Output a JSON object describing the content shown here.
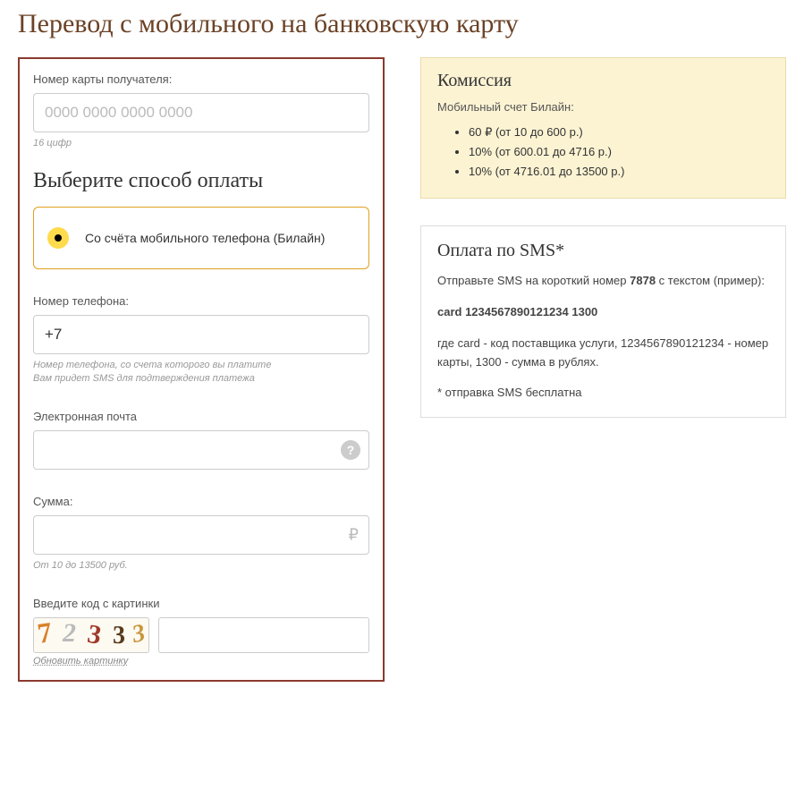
{
  "title": "Перевод с мобильного на банковскую карту",
  "form": {
    "card": {
      "label": "Номер карты получателя:",
      "placeholder": "0000 0000 0000 0000",
      "hint": "16 цифр"
    },
    "payment_method": {
      "title": "Выберите способ оплаты",
      "option_label": "Со счёта мобильного телефона (Билайн)"
    },
    "phone": {
      "label": "Номер телефона:",
      "value": "+7",
      "hint": "Номер телефона, со счета которого вы платите\nВам придет SMS для подтверждения платежа"
    },
    "email": {
      "label": "Электронная почта",
      "help_symbol": "?"
    },
    "amount": {
      "label": "Сумма:",
      "currency_symbol": "₽",
      "hint": "От 10 до 13500 руб."
    },
    "captcha": {
      "label": "Введите код с картинки",
      "chars": [
        "7",
        "2",
        "3",
        "3",
        "3"
      ],
      "refresh": "Обновить картинку"
    }
  },
  "commission": {
    "title": "Комиссия",
    "subtitle": "Мобильный счет Билайн:",
    "items": [
      "60 ₽ (от 10 до 600 р.)",
      "10% (от 600.01 до 4716 р.)",
      "10% (от 4716.01 до 13500 р.)"
    ]
  },
  "sms": {
    "title": "Оплата по SMS*",
    "intro_pre": "Отправьте SMS на короткий номер ",
    "intro_num": "7878",
    "intro_post": " с текстом (пример):",
    "example": "card 1234567890121234 1300",
    "explain": "где card - код поставщика услуги, 1234567890121234 - номер карты, 1300 - сумма в рублях.",
    "note": "* отправка SMS бесплатна"
  }
}
